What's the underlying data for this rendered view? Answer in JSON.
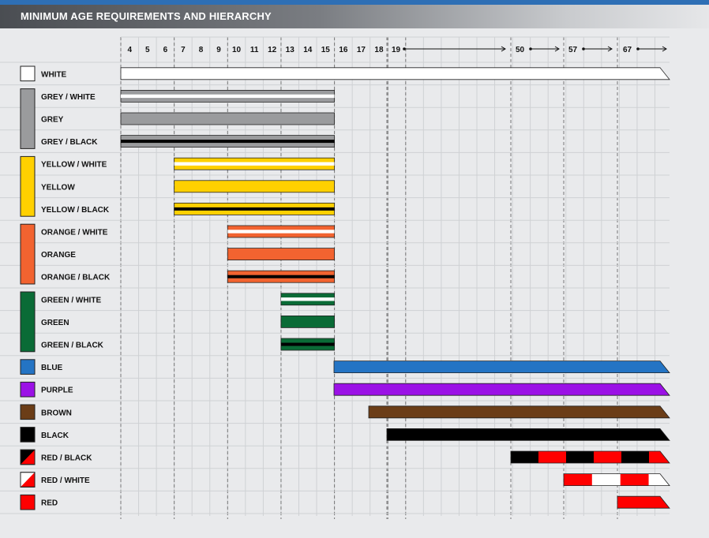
{
  "header": {
    "title": "MINIMUM AGE REQUIREMENTS AND HIERARCHY"
  },
  "chart_data": {
    "type": "bar",
    "title": "MINIMUM AGE REQUIREMENTS AND HIERARCHY",
    "xlabel": "",
    "ylabel": "",
    "x_ticks": [
      "4",
      "5",
      "6",
      "7",
      "8",
      "9",
      "10",
      "11",
      "12",
      "13",
      "14",
      "15",
      "16",
      "17",
      "18",
      "19",
      "50",
      "57",
      "67"
    ],
    "belts": [
      {
        "name": "WHITE",
        "start": "4",
        "open_ended": true,
        "pattern": "solid",
        "colors": [
          "#ffffff"
        ]
      },
      {
        "name": "GREY / WHITE",
        "start": "4",
        "end": "15",
        "pattern": "stripe-white",
        "colors": [
          "#9a9b9d",
          "#ffffff"
        ]
      },
      {
        "name": "GREY",
        "start": "4",
        "end": "15",
        "pattern": "solid",
        "colors": [
          "#9a9b9d"
        ]
      },
      {
        "name": "GREY / BLACK",
        "start": "4",
        "end": "15",
        "pattern": "stripe-black",
        "colors": [
          "#9a9b9d",
          "#000000"
        ]
      },
      {
        "name": "YELLOW / WHITE",
        "start": "7",
        "end": "15",
        "pattern": "stripe-white",
        "colors": [
          "#ffd000",
          "#ffffff"
        ]
      },
      {
        "name": "YELLOW",
        "start": "7",
        "end": "15",
        "pattern": "solid",
        "colors": [
          "#ffd000"
        ]
      },
      {
        "name": "YELLOW / BLACK",
        "start": "7",
        "end": "15",
        "pattern": "stripe-black",
        "colors": [
          "#ffd000",
          "#000000"
        ]
      },
      {
        "name": "ORANGE / WHITE",
        "start": "10",
        "end": "15",
        "pattern": "stripe-white",
        "colors": [
          "#f26330",
          "#ffffff"
        ]
      },
      {
        "name": "ORANGE",
        "start": "10",
        "end": "15",
        "pattern": "solid",
        "colors": [
          "#f26330"
        ]
      },
      {
        "name": "ORANGE / BLACK",
        "start": "10",
        "end": "15",
        "pattern": "stripe-black",
        "colors": [
          "#f26330",
          "#000000"
        ]
      },
      {
        "name": "GREEN / WHITE",
        "start": "13",
        "end": "15",
        "pattern": "stripe-white",
        "colors": [
          "#0a6b36",
          "#ffffff"
        ]
      },
      {
        "name": "GREEN",
        "start": "13",
        "end": "15",
        "pattern": "solid",
        "colors": [
          "#0a6b36"
        ]
      },
      {
        "name": "GREEN / BLACK",
        "start": "13",
        "end": "15",
        "pattern": "stripe-black",
        "colors": [
          "#0a6b36",
          "#000000"
        ]
      },
      {
        "name": "BLUE",
        "start": "16",
        "open_ended": true,
        "pattern": "solid",
        "colors": [
          "#2474c4"
        ]
      },
      {
        "name": "PURPLE",
        "start": "16",
        "open_ended": true,
        "pattern": "solid",
        "colors": [
          "#9b11e6"
        ]
      },
      {
        "name": "BROWN",
        "start": "18",
        "open_ended": true,
        "pattern": "solid",
        "colors": [
          "#6b3d17"
        ]
      },
      {
        "name": "BLACK",
        "start": "19",
        "open_ended": true,
        "pattern": "solid",
        "colors": [
          "#000000"
        ]
      },
      {
        "name": "RED / BLACK",
        "start": "50",
        "open_ended": true,
        "pattern": "blocks",
        "colors": [
          "#000000",
          "#ff0000"
        ]
      },
      {
        "name": "RED / WHITE",
        "start": "57",
        "open_ended": true,
        "pattern": "blocks",
        "colors": [
          "#ff0000",
          "#ffffff"
        ]
      },
      {
        "name": "RED",
        "start": "67",
        "open_ended": true,
        "pattern": "solid",
        "colors": [
          "#ff0000"
        ]
      }
    ],
    "swatch_groups": [
      {
        "rows": [
          0,
          0
        ],
        "type": "solid",
        "colors": [
          "#ffffff"
        ]
      },
      {
        "rows": [
          1,
          3
        ],
        "type": "solid",
        "colors": [
          "#9a9b9d"
        ]
      },
      {
        "rows": [
          4,
          6
        ],
        "type": "solid",
        "colors": [
          "#ffd000"
        ]
      },
      {
        "rows": [
          7,
          9
        ],
        "type": "solid",
        "colors": [
          "#f26330"
        ]
      },
      {
        "rows": [
          10,
          12
        ],
        "type": "solid",
        "colors": [
          "#0a6b36"
        ]
      },
      {
        "rows": [
          13,
          13
        ],
        "type": "solid",
        "colors": [
          "#2474c4"
        ]
      },
      {
        "rows": [
          14,
          14
        ],
        "type": "solid",
        "colors": [
          "#9b11e6"
        ]
      },
      {
        "rows": [
          15,
          15
        ],
        "type": "solid",
        "colors": [
          "#6b3d17"
        ]
      },
      {
        "rows": [
          16,
          16
        ],
        "type": "solid",
        "colors": [
          "#000000"
        ]
      },
      {
        "rows": [
          17,
          17
        ],
        "type": "diagonal",
        "colors": [
          "#ff0000",
          "#000000"
        ]
      },
      {
        "rows": [
          18,
          18
        ],
        "type": "diagonal",
        "colors": [
          "#ff0000",
          "#ffffff"
        ]
      },
      {
        "rows": [
          19,
          19
        ],
        "type": "solid",
        "colors": [
          "#ff0000"
        ]
      }
    ],
    "grid": true,
    "legend": "none"
  }
}
